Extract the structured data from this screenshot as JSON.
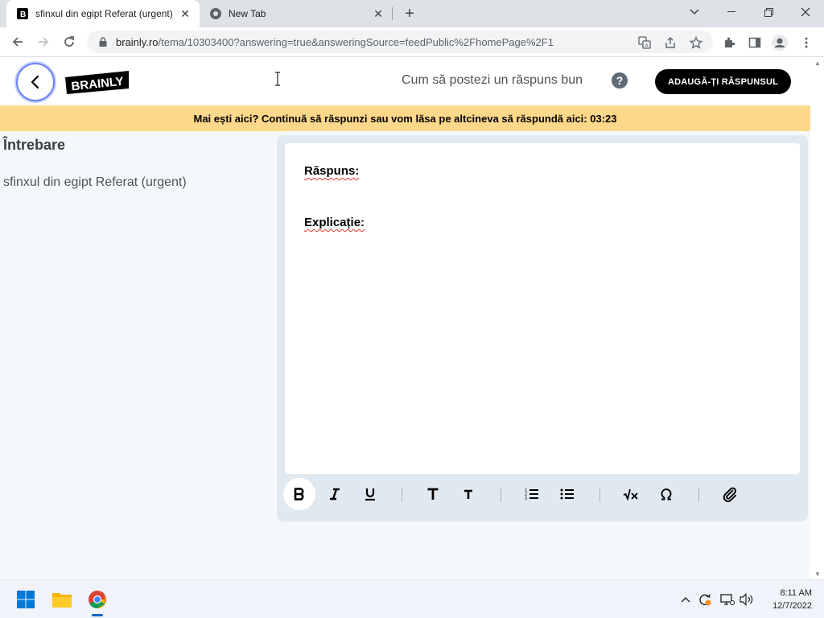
{
  "browser": {
    "tabs": [
      {
        "title": "sfinxul din egipt Referat (urgent)",
        "active": true,
        "favicon": "brainly-favicon"
      },
      {
        "title": "New Tab",
        "active": false,
        "favicon": "chrome-favicon"
      }
    ],
    "url_host": "brainly.ro",
    "url_path": "/tema/10303400?answering=true&answeringSource=feedPublic%2FhomePage%2F1"
  },
  "site": {
    "logo_text": "BRAINLY",
    "howto_text": "Cum să postezi un răspuns bun",
    "help_symbol": "?",
    "add_answer_label": "ADAUGĂ-ȚI RĂSPUNSUL",
    "banner_text": "Mai ești aici? Continuă să răspunzi sau vom lăsa pe altcineva să răspundă aici: 03:23"
  },
  "question": {
    "heading": "Întrebare",
    "text": "sfinxul din egipt Referat (urgent)"
  },
  "editor": {
    "line1": "Răspuns:",
    "line2": "Explicație:"
  },
  "taskbar": {
    "time": "8:11 AM",
    "date": "12/7/2022"
  },
  "colors": {
    "banner_bg": "#fdd88a",
    "button_bg": "#000000",
    "editor_panel": "#e1e9f0",
    "page_bg": "#f5f8fa"
  }
}
